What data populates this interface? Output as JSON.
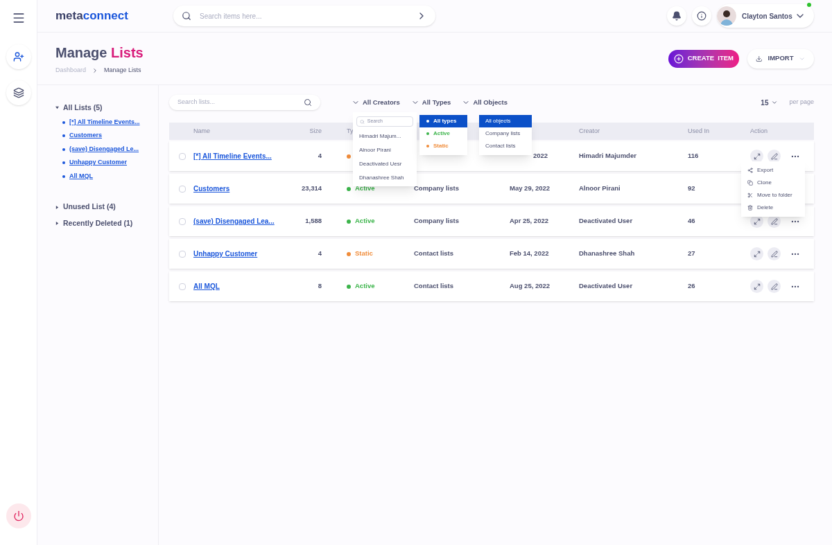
{
  "brand": {
    "part1": "meta",
    "part2": "connect"
  },
  "search": {
    "placeholder": "Search items here..."
  },
  "user": {
    "name": "Clayton Santos",
    "online": true
  },
  "page": {
    "title1": "Manage",
    "title2": "Lists",
    "breadcrumb": [
      "Dashboard",
      "Manage Lists"
    ]
  },
  "buttons": {
    "create": "CREATE  ITEM",
    "import": "IMPORT"
  },
  "sidebar": {
    "groups": [
      {
        "label": "All Lists (5)",
        "expanded": true,
        "children": [
          "[*] All Timeline Events...",
          "Customers",
          "(save) Disengaged Le...",
          "Unhappy Customer",
          "All MQL"
        ]
      },
      {
        "label": "Unused List (4)",
        "expanded": false
      },
      {
        "label": "Recently Deleted (1)",
        "expanded": false
      }
    ]
  },
  "filters": {
    "search_placeholder": "Search lists...",
    "dropdowns": [
      "All Creators",
      "All Types",
      "All Objects"
    ],
    "per_page": "15",
    "per_page_label": "per page"
  },
  "table": {
    "columns": [
      "Name",
      "Size",
      "Ty",
      "",
      "",
      "Creator",
      "Used In",
      "Action"
    ],
    "rows": [
      {
        "checked": false,
        "name": "[*] All Timeline Events...",
        "size": "4",
        "status": {
          "kind": "static"
        },
        "date": "2022",
        "creator": "Himadri Majumder",
        "used_in": "116",
        "actions": [
          {
            "kind": "expand"
          },
          {
            "kind": "edit"
          },
          {
            "kind": "more"
          }
        ]
      },
      {
        "checked": false,
        "name": "Customers",
        "size": "23,314",
        "status": {
          "kind": "active",
          "label": "Active"
        },
        "object": "Company lists",
        "date": "May 29, 2022",
        "creator": "Alnoor Pirani",
        "used_in": "92"
      },
      {
        "checked": false,
        "name": "(save) Disengaged Lea...",
        "size": "1,588",
        "status": {
          "kind": "active",
          "label": "Active"
        },
        "object": "Company lists",
        "date": "Apr 25, 2022",
        "creator": "Deactivated User",
        "used_in": "46",
        "actions": [
          {
            "kind": "expand"
          },
          {
            "kind": "edit"
          },
          {
            "kind": "more"
          }
        ]
      },
      {
        "checked": false,
        "name": "Unhappy Customer",
        "size": "4",
        "status": {
          "kind": "static",
          "label": "Static"
        },
        "object": "Contact lists",
        "date": "Feb 14, 2022",
        "creator": "Dhanashree Shah",
        "used_in": "27",
        "actions": [
          {
            "kind": "expand"
          },
          {
            "kind": "edit"
          },
          {
            "kind": "more"
          }
        ]
      },
      {
        "checked": false,
        "name": "All MQL",
        "size": "8",
        "status": {
          "kind": "active",
          "label": "Active"
        },
        "object": "Contact lists",
        "date": "Aug 25, 2022",
        "creator": "Deactivated User",
        "used_in": "26",
        "actions": [
          {
            "kind": "expand"
          },
          {
            "kind": "edit"
          },
          {
            "kind": "more"
          }
        ]
      }
    ]
  },
  "creators_menu": {
    "search_placeholder": "Search",
    "items": [
      "Himadri Majum...",
      "Alnoor Pirani",
      "Deactivated Uesr",
      "Dhanashree Shah"
    ]
  },
  "types_menu": [
    {
      "label": "All types",
      "kind": "all",
      "selected": true
    },
    {
      "label": "Active",
      "kind": "active",
      "selected": false
    },
    {
      "label": "Static",
      "kind": "static",
      "selected": false
    }
  ],
  "objects_menu": [
    {
      "label": "All objects",
      "selected": true
    },
    {
      "label": "Company lists",
      "selected": false
    },
    {
      "label": "Contact lists",
      "selected": false
    }
  ],
  "action_menu": [
    {
      "label": "Export",
      "kind": "export"
    },
    {
      "label": "Clone",
      "kind": "clone"
    },
    {
      "label": "Move to folder",
      "kind": "move"
    },
    {
      "label": "Delete",
      "kind": "delete"
    }
  ]
}
